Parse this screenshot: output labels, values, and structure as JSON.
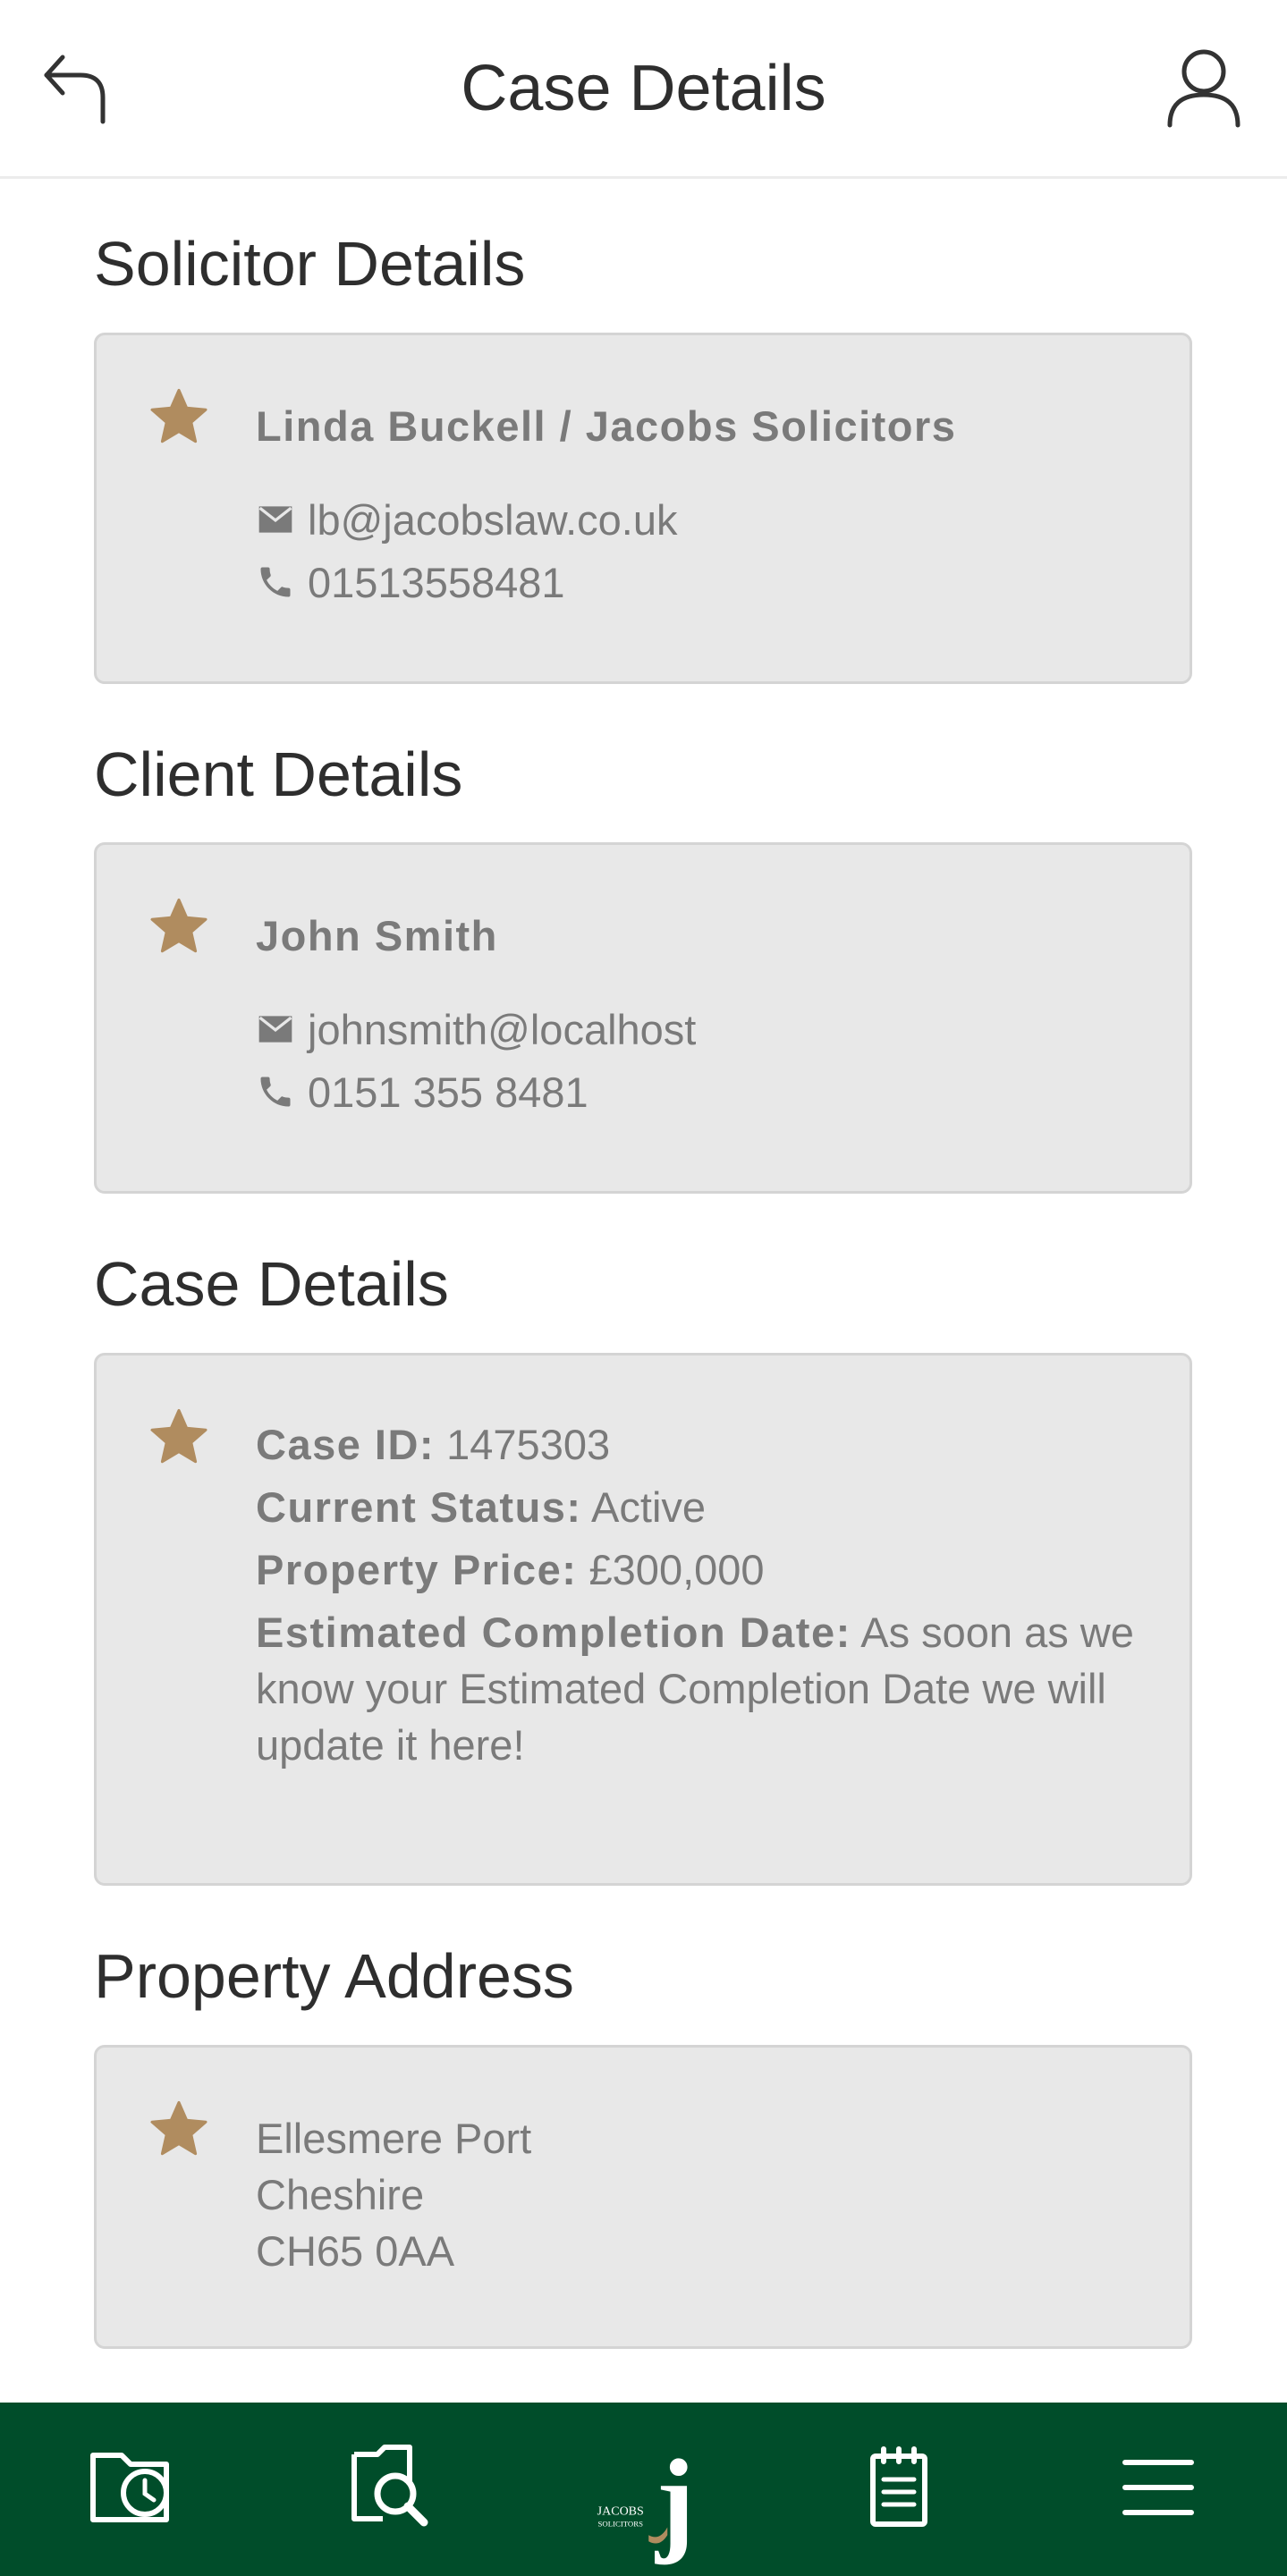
{
  "header": {
    "title": "Case Details",
    "back_icon": "back-arrow-icon",
    "user_icon": "user-profile-icon"
  },
  "solicitor": {
    "section_title": "Solicitor Details",
    "name": "Linda Buckell / Jacobs Solicitors",
    "email": "lb@jacobslaw.co.uk",
    "phone": "01513558481"
  },
  "client": {
    "section_title": "Client Details",
    "name": "John Smith",
    "email": "johnsmith@localhost",
    "phone": "0151 355 8481"
  },
  "case": {
    "section_title": "Case Details",
    "case_id_label": "Case ID:",
    "case_id_value": " 1475303",
    "status_label": "Current Status:",
    "status_value": " Active",
    "price_label": "Property Price:",
    "price_value": " £300,000",
    "completion_label": "Estimated Completion Date:",
    "completion_value": " As soon as we know your Estimated Completion Date we will update it here!"
  },
  "property": {
    "section_title": "Property Address",
    "lines": [
      "Ellesmere Port",
      "Cheshire",
      "CH65 0AA"
    ]
  },
  "bottom_nav": {
    "items": [
      "case-history-icon",
      "search-documents-icon",
      "jacobs-home-logo",
      "notes-icon",
      "menu-icon"
    ],
    "logo_text_top": "JACOBS",
    "logo_text_bottom": "SOLICITORS",
    "logo_letter": "j"
  },
  "colors": {
    "accent_star": "#b08c5f",
    "nav_background": "#004d2a",
    "card_background": "#e8e8e8"
  }
}
